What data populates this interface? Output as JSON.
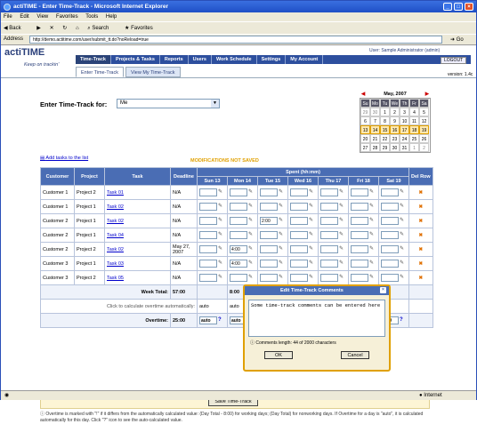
{
  "window": {
    "title": "actiTIME - Enter Time-Track - Microsoft Internet Explorer"
  },
  "menu": [
    "File",
    "Edit",
    "View",
    "Favorites",
    "Tools",
    "Help"
  ],
  "toolbar": {
    "back": "Back",
    "search": "Search",
    "favorites": "Favorites"
  },
  "address": {
    "label": "Address",
    "url": "http://demo.actitime.com/user/submit_tt.do?noReload=true",
    "go": "Go"
  },
  "status": {
    "zone": "Internet"
  },
  "app": {
    "logo": "actiTIME",
    "tagline": "Keep on trackin'",
    "user": "User: Sample Administrator (admin)",
    "logout": "LOGOUT",
    "version": "version: 1.4c",
    "nav": [
      "Time-Track",
      "Projects & Tasks",
      "Reports",
      "Users",
      "Work Schedule",
      "Settings",
      "My Account"
    ],
    "subtabs": [
      "Enter Time-Track",
      "View My Time-Track"
    ]
  },
  "for": {
    "label": "Enter Time-Track for:",
    "value": "Me"
  },
  "calendar": {
    "month": "May, 2007",
    "days": [
      "Su",
      "Mo",
      "Tu",
      "We",
      "Th",
      "Fr",
      "Sa"
    ],
    "weeks": [
      [
        "29",
        "30",
        "1",
        "2",
        "3",
        "4",
        "5"
      ],
      [
        "6",
        "7",
        "8",
        "9",
        "10",
        "11",
        "12"
      ],
      [
        "13",
        "14",
        "15",
        "16",
        "17",
        "18",
        "19"
      ],
      [
        "20",
        "21",
        "22",
        "23",
        "24",
        "25",
        "26"
      ],
      [
        "27",
        "28",
        "29",
        "30",
        "31",
        "1",
        "2"
      ]
    ]
  },
  "addtask": "Add tasks to the list",
  "modmsg": "MODIFICATIONS NOT SAVED",
  "table": {
    "headers": {
      "customer": "Customer",
      "project": "Project",
      "task": "Task",
      "deadline": "Deadline",
      "spent": "Spent (hh:mm)",
      "del": "Del Row"
    },
    "days": [
      "Sun 13",
      "Mon 14",
      "Tue 15",
      "Wed 16",
      "Thu 17",
      "Fri 18",
      "Sat 19"
    ],
    "rows": [
      {
        "customer": "Customer 1",
        "project": "Project 2",
        "task": "Task 01",
        "deadline": "N/A",
        "vals": [
          "",
          "",
          "",
          "",
          "",
          "",
          ""
        ]
      },
      {
        "customer": "Customer 1",
        "project": "Project 1",
        "task": "Task 02",
        "deadline": "N/A",
        "vals": [
          "",
          "",
          "",
          "",
          "",
          "",
          ""
        ]
      },
      {
        "customer": "Customer 2",
        "project": "Project 1",
        "task": "Task 02",
        "deadline": "N/A",
        "vals": [
          "",
          "",
          "2:00",
          "",
          "",
          "",
          ""
        ]
      },
      {
        "customer": "Customer 2",
        "project": "Project 1",
        "task": "Task 04",
        "deadline": "N/A",
        "vals": [
          "",
          "",
          "",
          "",
          "",
          "",
          ""
        ]
      },
      {
        "customer": "Customer 2",
        "project": "Project 2",
        "task": "Task 02",
        "deadline": "May 27, 2007",
        "vals": [
          "",
          "4:00",
          "",
          "",
          "",
          "",
          ""
        ]
      },
      {
        "customer": "Customer 3",
        "project": "Project 1",
        "task": "Task 03",
        "deadline": "N/A",
        "vals": [
          "",
          "4:00",
          "",
          "",
          "",
          "",
          ""
        ]
      },
      {
        "customer": "Customer 3",
        "project": "Project 2",
        "task": "Task 05",
        "deadline": "N/A",
        "vals": [
          "",
          "",
          "",
          "",
          "",
          "",
          ""
        ]
      }
    ],
    "weektotal_label": "Week Total:",
    "weektotal": "57:00",
    "daytotals": [
      "",
      "8:00",
      "8:00",
      "",
      "",
      "",
      ""
    ],
    "calc_label": "Click to calculate overtime automatically:",
    "calc": "auto",
    "overtime_label": "Overtime:",
    "overtime": "25:00",
    "ot": [
      "auto",
      "auto",
      "auto",
      "auto",
      "auto",
      "8:00",
      "8:00"
    ]
  },
  "dialog": {
    "title": "Edit Time-Track Comments",
    "text": "Some time-track comments can be entered here",
    "length": "Comments length: 44 of 2000 characters",
    "ok": "OK",
    "cancel": "Cancel"
  },
  "save": "Save Time-Track",
  "note": "Overtime is marked with \"!\" if it differs from the automatically calculated value: (Day Total - 8:00) for working days; (Day Total) for nonworking days. If Overtime for a day is \"auto\", it is calculated automatically for this day. Click \"?\" icon to see the auto-calculated value."
}
